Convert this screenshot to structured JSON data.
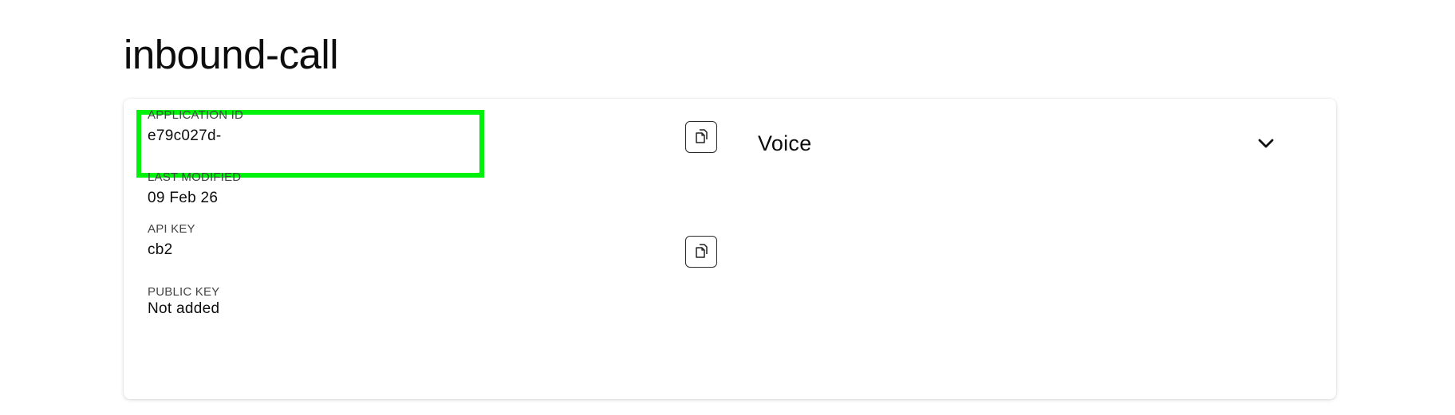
{
  "page": {
    "title": "inbound-call"
  },
  "details": {
    "application_id": {
      "label": "APPLICATION ID",
      "value": "e79c027d-"
    },
    "last_modified": {
      "label": "LAST MODIFIED",
      "value": "09 Feb 26"
    },
    "api_key": {
      "label": "API KEY",
      "value": "cb2"
    },
    "public_key": {
      "label": "PUBLIC KEY",
      "value": "Not added"
    }
  },
  "capability": {
    "title": "Voice",
    "icon": "chevron-down-icon"
  },
  "icons": {
    "copy": "copy-icon"
  },
  "colors": {
    "highlight": "#00f20c",
    "text": "#0d0d0d",
    "label": "#444444"
  }
}
